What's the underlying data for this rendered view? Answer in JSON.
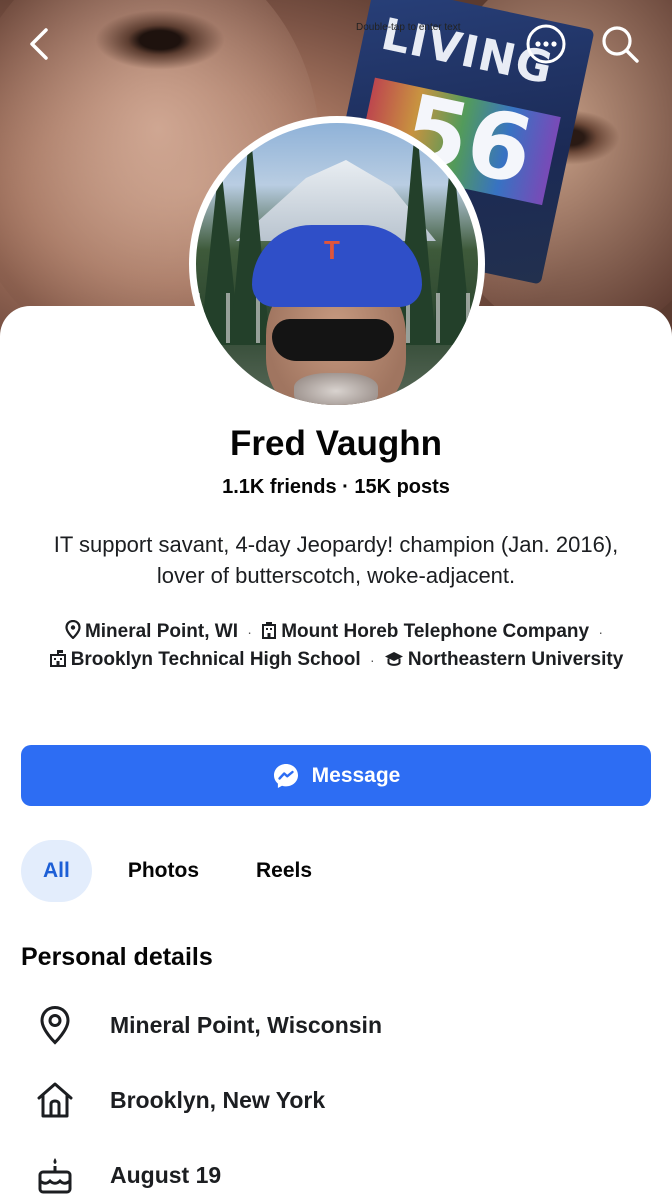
{
  "cover": {
    "sign_text": "LIVING",
    "sign_number": "56",
    "caption": "Double-tap to enter text"
  },
  "header": {
    "back_icon": "back-chevron-icon",
    "more_icon": "more-options-icon",
    "search_icon": "search-icon"
  },
  "profile": {
    "name": "Fred Vaughn",
    "stats": "1.1K friends · 15K posts",
    "bio": "IT support savant, 4-day Jeopardy! champion (Jan. 2016), lover of butterscotch, woke-adjacent.",
    "meta": {
      "location": "Mineral Point, WI",
      "work": "Mount Horeb Telephone Company",
      "high_school": "Brooklyn Technical High School",
      "college": "Northeastern University",
      "separator": "·"
    }
  },
  "actions": {
    "message_label": "Message",
    "message_icon": "messenger-icon",
    "accent_color": "#2d6df3"
  },
  "tabs": [
    {
      "label": "All",
      "active": true
    },
    {
      "label": "Photos",
      "active": false
    },
    {
      "label": "Reels",
      "active": false
    }
  ],
  "personal_details": {
    "title": "Personal details",
    "items": [
      {
        "icon": "location-pin-icon",
        "text": "Mineral Point, Wisconsin"
      },
      {
        "icon": "home-icon",
        "text": "Brooklyn, New York"
      },
      {
        "icon": "birthday-cake-icon",
        "text": "August 19"
      }
    ]
  }
}
